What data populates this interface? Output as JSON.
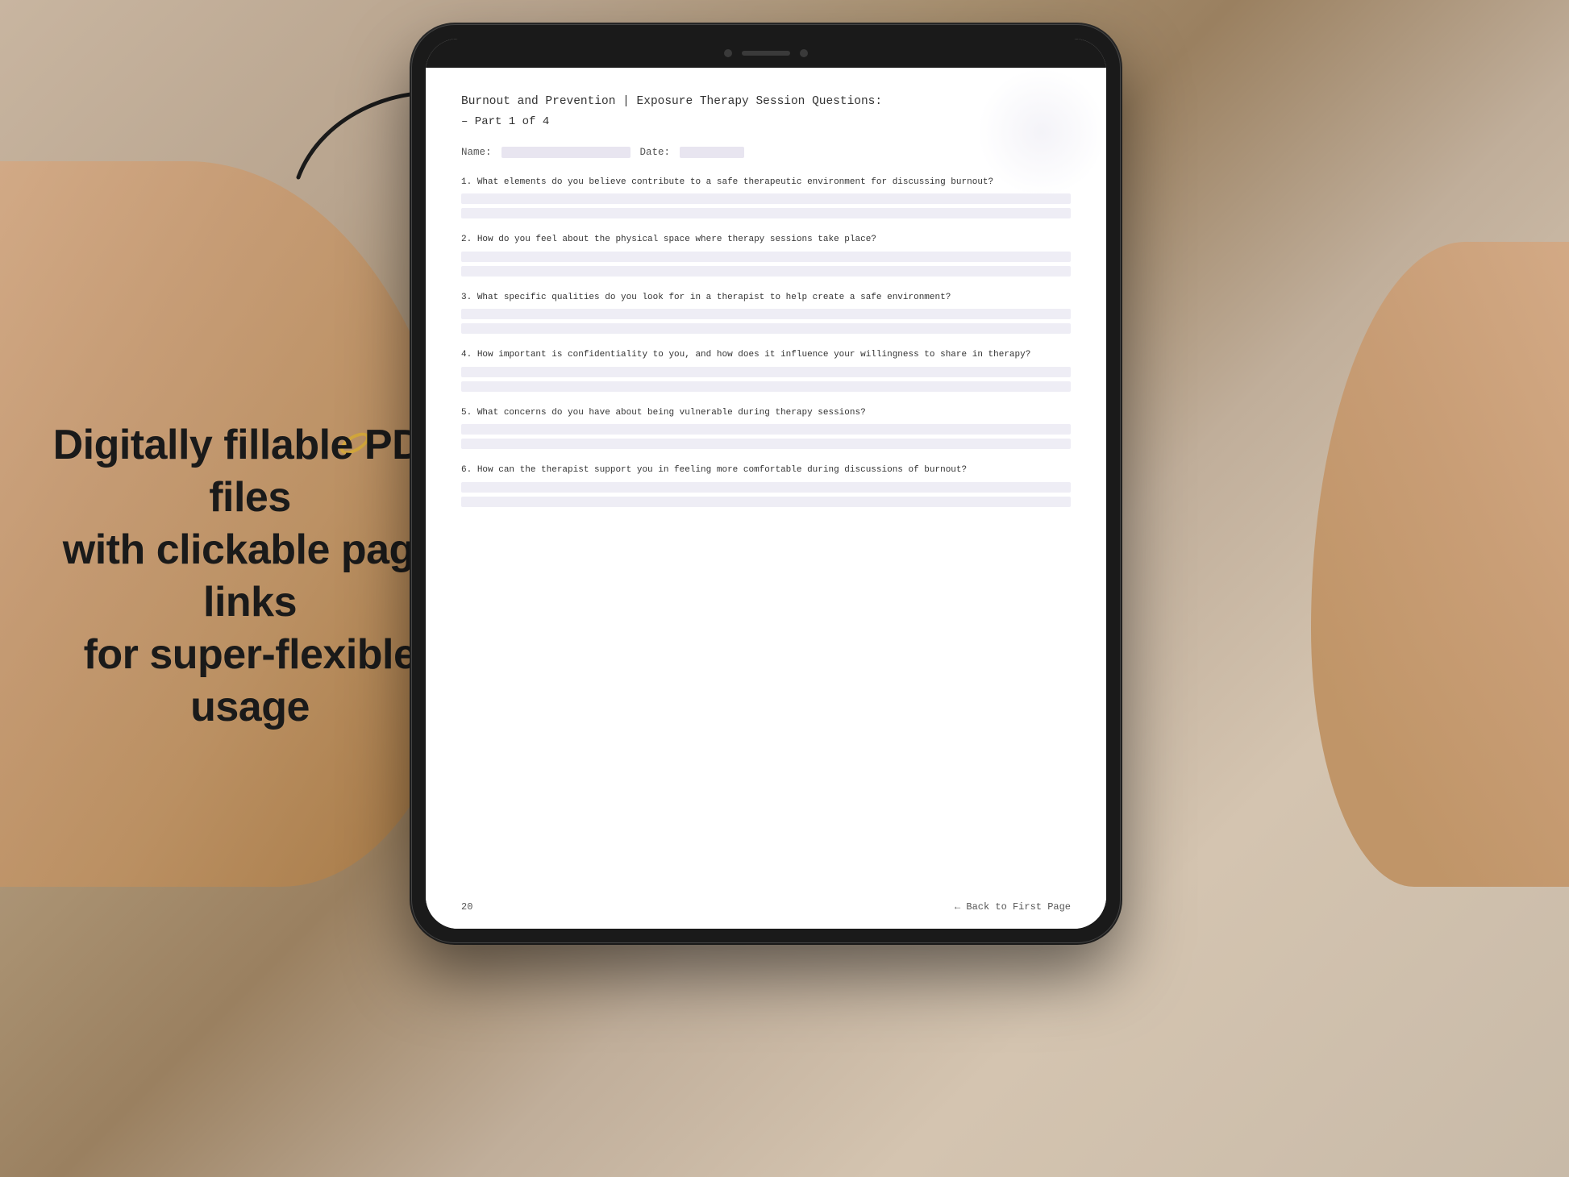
{
  "background": {
    "color": "#b5a090"
  },
  "left_text": {
    "line1": "Digitally fillable PDF files",
    "line2": "with clickable page links",
    "line3": "for super-flexible usage"
  },
  "arrow": {
    "description": "curved arrow pointing right toward iPad"
  },
  "pdf": {
    "title_line1": "Burnout and Prevention | Exposure Therapy Session Questions:",
    "title_line2": "– Part 1 of 4",
    "name_label": "Name:",
    "date_label": "Date:",
    "questions": [
      {
        "number": "1.",
        "text": "What elements do you believe contribute to a safe therapeutic environment for discussing burnout?"
      },
      {
        "number": "2.",
        "text": "How do you feel about the physical space where therapy sessions take place?"
      },
      {
        "number": "3.",
        "text": "What specific qualities do you look for in a therapist to help create a safe environment?"
      },
      {
        "number": "4.",
        "text": "How important is confidentiality to you, and how does it influence your willingness to share in therapy?"
      },
      {
        "number": "5.",
        "text": "What concerns do you have about being vulnerable during therapy sessions?"
      },
      {
        "number": "6.",
        "text": "How can the therapist support you in feeling more comfortable during discussions of burnout?"
      }
    ],
    "footer": {
      "page_number": "20",
      "back_link": "← Back to First Page"
    }
  }
}
